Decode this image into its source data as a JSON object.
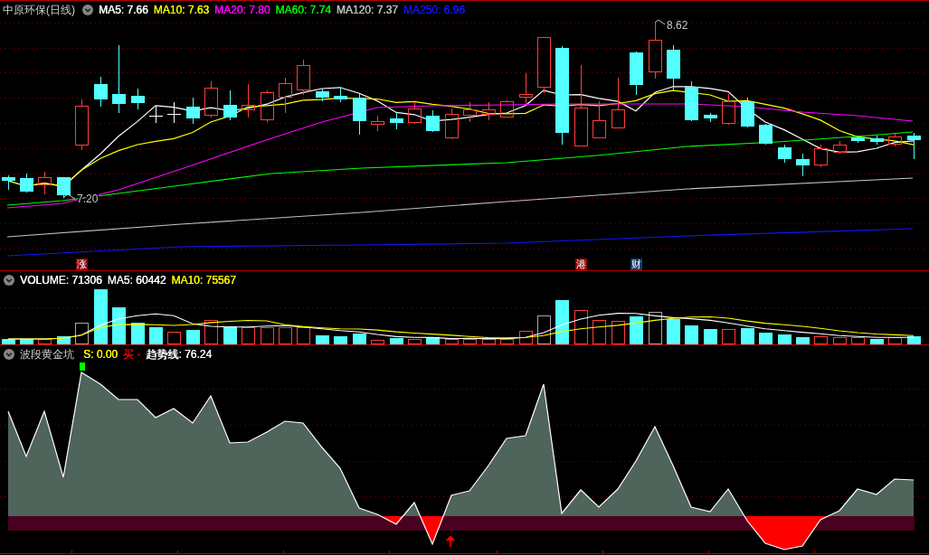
{
  "main_chart": {
    "title": "中原环保(日线)",
    "indicators": [
      {
        "label": "MA5: 7.66",
        "color": "#ffffff"
      },
      {
        "label": "MA10: 7.63",
        "color": "#ffff00"
      },
      {
        "label": "MA20: 7.80",
        "color": "#ff00ff"
      },
      {
        "label": "MA60: 7.74",
        "color": "#00ff00"
      },
      {
        "label": "MA120: 7.37",
        "color": "#c0c0c0"
      },
      {
        "label": "MA250: 6.96",
        "color": "#1414ff"
      }
    ],
    "high_label": "8.62",
    "low_label": "7.20",
    "event_markers": [
      {
        "label": "涨",
        "color": "#8c0a0a"
      },
      {
        "label": "港",
        "color": "#8c0a0a"
      },
      {
        "label": "财",
        "color": "#123c6e"
      }
    ]
  },
  "volume_chart": {
    "indicators": [
      {
        "label": "VOLUME: 71306",
        "color": "#ffffff"
      },
      {
        "label": "MA5: 60442",
        "color": "#ffffff"
      },
      {
        "label": "MA10: 75567",
        "color": "#ffff00"
      }
    ]
  },
  "oscillator": {
    "title": "波段黄金坑",
    "indicators": [
      {
        "label": "S: 0.00",
        "color": "#ffff00"
      },
      {
        "label": "买 -",
        "color": "#ff0000"
      },
      {
        "label": "趋势线: 76.24",
        "color": "#ffffff"
      }
    ]
  }
}
